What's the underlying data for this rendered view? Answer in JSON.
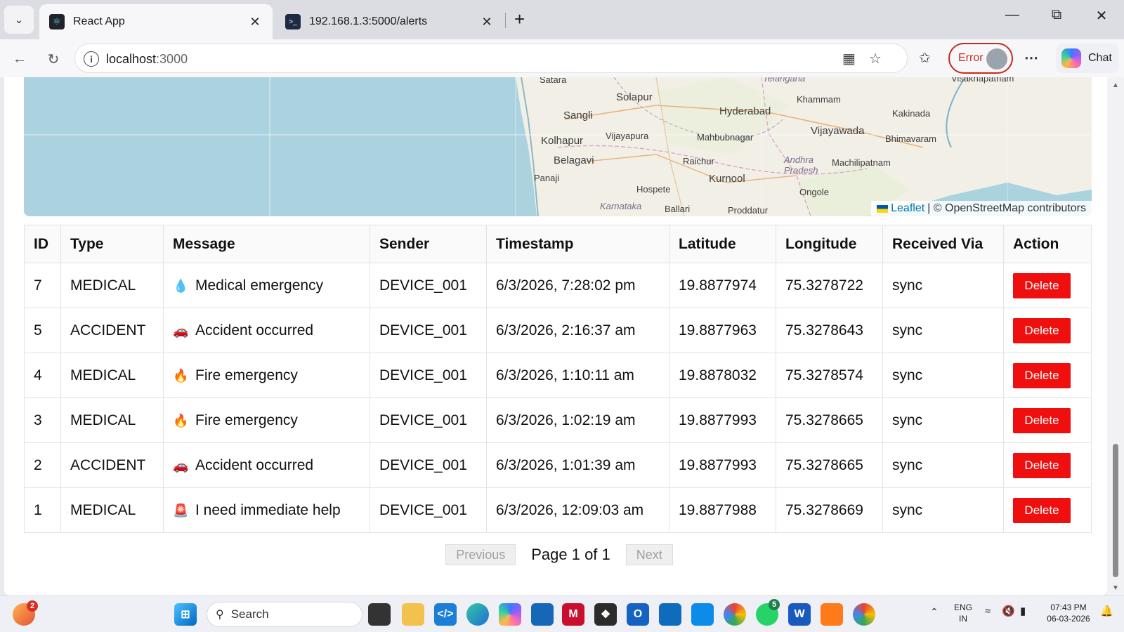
{
  "browser": {
    "tabs": [
      {
        "title": "React App",
        "icon": "react-icon",
        "active": true
      },
      {
        "title": "192.168.1.3:5000/alerts",
        "icon": "terminal-icon",
        "active": false
      }
    ],
    "address": {
      "host": "localhost",
      "port": ":3000"
    },
    "profile_status": "Error",
    "chat_label": "Chat"
  },
  "map": {
    "labels": [
      "Satara",
      "Solapur",
      "Sangli",
      "Hyderabad",
      "Khammam",
      "Visakhapatnam",
      "Kakinada",
      "Vijayapura",
      "Mahbubnagar",
      "Vijayawada",
      "Bhimavaram",
      "Kolhapur",
      "Belagavi",
      "Raichur",
      "Machilipatnam",
      "Panaji",
      "Kurnool",
      "Hospete",
      "Ongole",
      "Ballari",
      "Proddatur",
      "Telangana",
      "Andhra Pradesh",
      "Karnataka"
    ],
    "attribution_leaflet": "Leaflet",
    "attribution_text": "| © OpenStreetMap contributors"
  },
  "table": {
    "headers": [
      "ID",
      "Type",
      "Message",
      "Sender",
      "Timestamp",
      "Latitude",
      "Longitude",
      "Received Via",
      "Action"
    ],
    "rows": [
      {
        "id": "7",
        "type": "MEDICAL",
        "icon": "blood-drop-icon",
        "glyph": "💧",
        "message": "Medical emergency",
        "sender": "DEVICE_001",
        "timestamp": "6/3/2026, 7:28:02 pm",
        "lat": "19.8877974",
        "lng": "75.3278722",
        "via": "sync",
        "action": "Delete"
      },
      {
        "id": "5",
        "type": "ACCIDENT",
        "icon": "car-icon",
        "glyph": "🚗",
        "message": "Accident occurred",
        "sender": "DEVICE_001",
        "timestamp": "6/3/2026, 2:16:37 am",
        "lat": "19.8877963",
        "lng": "75.3278643",
        "via": "sync",
        "action": "Delete"
      },
      {
        "id": "4",
        "type": "MEDICAL",
        "icon": "fire-icon",
        "glyph": "🔥",
        "message": "Fire emergency",
        "sender": "DEVICE_001",
        "timestamp": "6/3/2026, 1:10:11 am",
        "lat": "19.8878032",
        "lng": "75.3278574",
        "via": "sync",
        "action": "Delete"
      },
      {
        "id": "3",
        "type": "MEDICAL",
        "icon": "fire-icon",
        "glyph": "🔥",
        "message": "Fire emergency",
        "sender": "DEVICE_001",
        "timestamp": "6/3/2026, 1:02:19 am",
        "lat": "19.8877993",
        "lng": "75.3278665",
        "via": "sync",
        "action": "Delete"
      },
      {
        "id": "2",
        "type": "ACCIDENT",
        "icon": "car-icon",
        "glyph": "🚗",
        "message": "Accident occurred",
        "sender": "DEVICE_001",
        "timestamp": "6/3/2026, 1:01:39 am",
        "lat": "19.8877993",
        "lng": "75.3278665",
        "via": "sync",
        "action": "Delete"
      },
      {
        "id": "1",
        "type": "MEDICAL",
        "icon": "siren-icon",
        "glyph": "🚨",
        "message": "I need immediate help",
        "sender": "DEVICE_001",
        "timestamp": "6/3/2026, 12:09:03 am",
        "lat": "19.8877988",
        "lng": "75.3278669",
        "via": "sync",
        "action": "Delete"
      }
    ]
  },
  "pagination": {
    "previous": "Previous",
    "page_text": "Page 1 of 1",
    "next": "Next"
  },
  "taskbar": {
    "search_label": "Search",
    "language": "ENG",
    "region": "IN",
    "time": "07:43 PM",
    "date": "06-03-2026",
    "notification_badge": "2",
    "whatsapp_badge": "5"
  },
  "colors": {
    "delete_button": "#f00f0f",
    "map_water": "#aad3df",
    "error_outline": "#c42b1c"
  }
}
